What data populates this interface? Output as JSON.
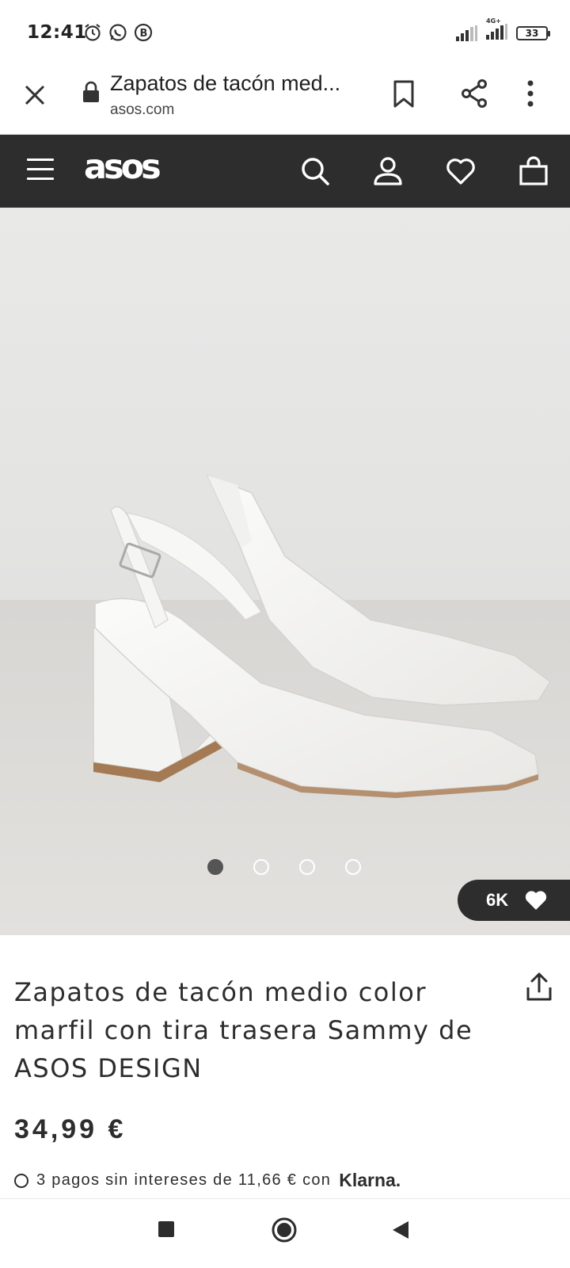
{
  "status": {
    "time": "12:41",
    "net_label": "4G+",
    "battery": "33"
  },
  "tab": {
    "title": "Zapatos de tacón med...",
    "url": "asos.com"
  },
  "nav": {
    "logo": "asos"
  },
  "product": {
    "likes": "6K",
    "title": "Zapatos de tacón medio color marfil con tira trasera Sammy de ASOS DESIGN",
    "price": "34,99 €",
    "installments": "3 pagos sin intereses de 11,66 € con",
    "installments_prefix": "O",
    "klarna": "Klarna.",
    "carousel_count": 4,
    "carousel_active": 0
  },
  "icons": {
    "status": [
      "alarm-icon",
      "whatsapp-icon",
      "b-app-icon",
      "signal-icon",
      "battery-icon"
    ],
    "tab": [
      "close-icon",
      "lock-icon",
      "bookmark-icon",
      "share-icon",
      "more-vert-icon"
    ],
    "nav": [
      "menu-icon",
      "search-icon",
      "account-icon",
      "heart-icon",
      "bag-icon"
    ],
    "system": [
      "recents-square-icon",
      "home-circle-icon",
      "back-triangle-icon"
    ]
  },
  "colors": {
    "nav_bg": "#2d2d2d",
    "text": "#2d2d2d",
    "image_bg": "#e7e7e6"
  }
}
